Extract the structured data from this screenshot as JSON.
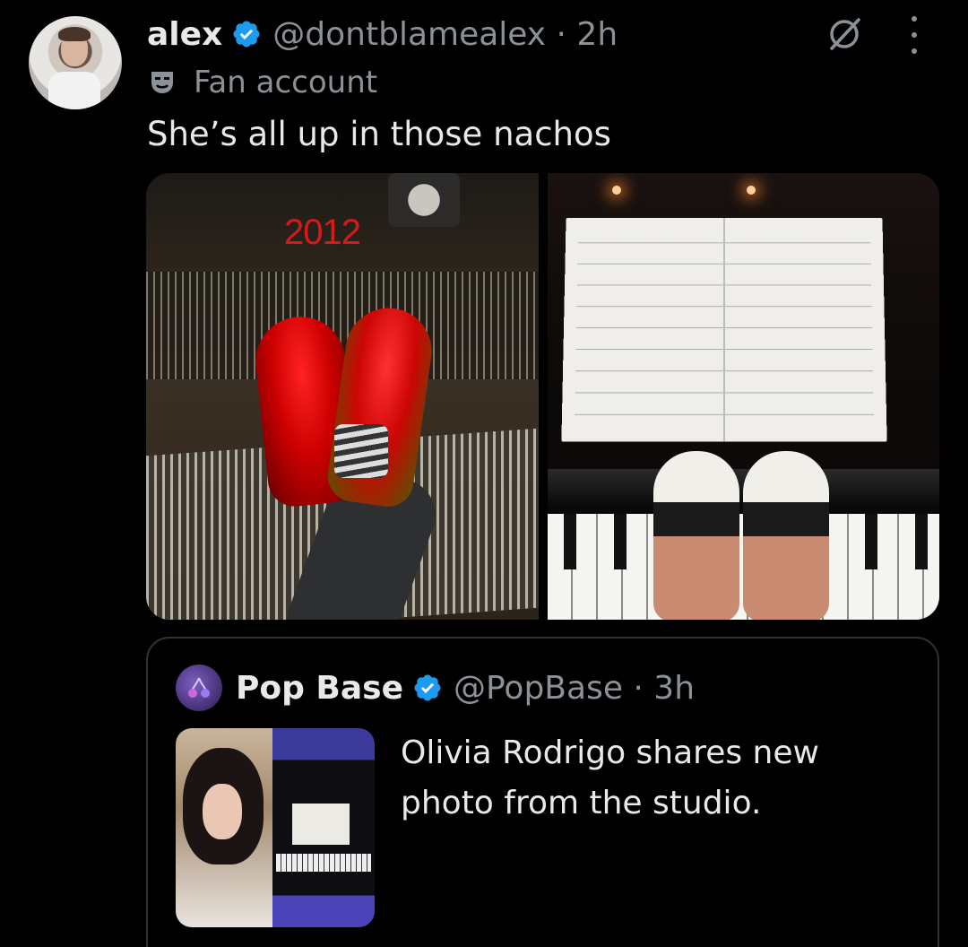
{
  "tweet": {
    "author_name": "alex",
    "handle_time": "@dontblamealex · 2h",
    "label": "Fan account",
    "text": "She’s all up in those nachos",
    "media_overlay_text": "2012"
  },
  "quoted": {
    "author_name": "Pop Base",
    "handle_time": "@PopBase · 3h",
    "text": "Olivia Rodrigo shares new photo from the studio."
  },
  "icons": {
    "verified": "verified-badge-icon",
    "label_badge": "mask-icon",
    "grok": "grok-icon",
    "more": "more-options-icon"
  },
  "colors": {
    "background": "#000000",
    "text": "#e7e9ea",
    "secondary_text": "#8b9196",
    "verified_blue": "#1d9bf0",
    "border": "#2f3336",
    "overlay_red": "#d41b1b"
  }
}
